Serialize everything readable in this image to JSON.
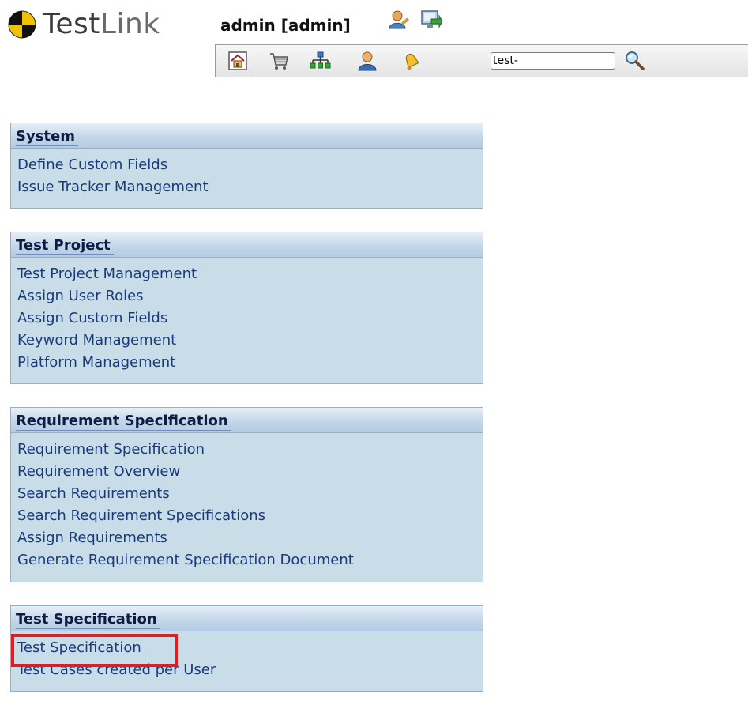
{
  "logo": {
    "text_dark": "Test",
    "text_light": "Link"
  },
  "header": {
    "user": "admin [admin]",
    "icons": [
      "user-settings-icon",
      "logout-icon"
    ]
  },
  "toolbar": {
    "buttons": [
      "home-icon",
      "cart-icon",
      "sitemap-icon",
      "user-icon",
      "bell-icon"
    ],
    "search_value": "test-",
    "search_icon": "magnifier-icon"
  },
  "sections": [
    {
      "title": "System",
      "links": [
        "Define Custom Fields",
        "Issue Tracker Management"
      ]
    },
    {
      "title": "Test Project",
      "links": [
        "Test Project Management",
        "Assign User Roles",
        "Assign Custom Fields",
        "Keyword Management",
        "Platform Management"
      ]
    },
    {
      "title": "Requirement Specification",
      "links": [
        "Requirement Specification",
        "Requirement Overview",
        "Search Requirements",
        "Search Requirement Specifications",
        "Assign Requirements",
        "Generate Requirement Specification Document"
      ]
    },
    {
      "title": "Test Specification",
      "links": [
        "Test Specification",
        "Test Cases created per User"
      ]
    }
  ],
  "colors": {
    "section_bg": "#c9dde8",
    "link": "#1a3b7a",
    "highlight": "#e31b23"
  }
}
